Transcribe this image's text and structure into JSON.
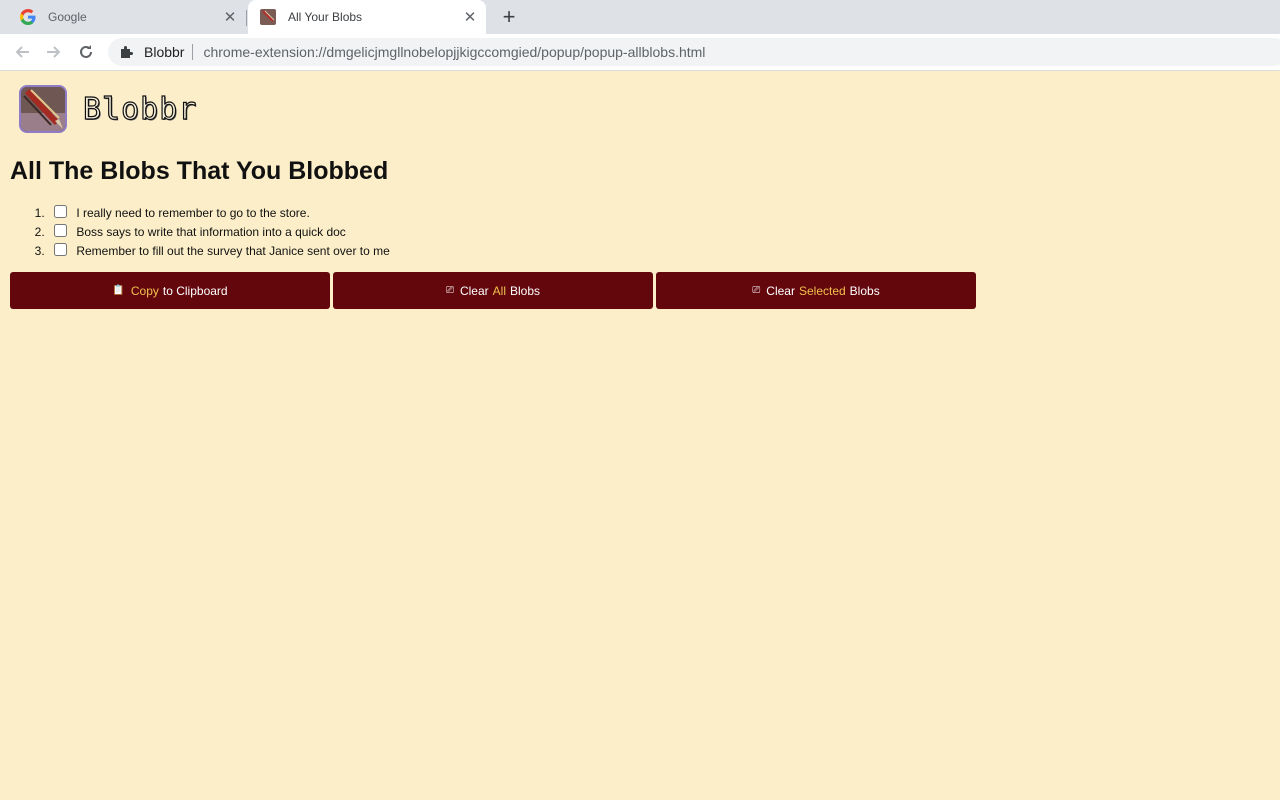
{
  "browser": {
    "tabs": [
      {
        "title": "Google",
        "favicon": "google-g-icon",
        "active": false
      },
      {
        "title": "All Your Blobs",
        "favicon": "blobbr-icon",
        "active": true
      }
    ],
    "address": {
      "extension_name": "Blobbr",
      "url": "chrome-extension://dmgelicjmgllnobelopjjkigccomgied/popup/popup-allblobs.html"
    }
  },
  "app": {
    "name": "Blobbr",
    "heading": "All The Blobs That You Blobbed",
    "background_color": "#fbeec8",
    "accent_color": "#63070d",
    "highlight_color": "#f2c14e"
  },
  "blobs": [
    {
      "number": "1.",
      "text": "I really need to remember to go to the store.",
      "checked": false
    },
    {
      "number": "2.",
      "text": "Boss says to write that information into a quick doc",
      "checked": false
    },
    {
      "number": "3.",
      "text": "Remember to fill out the survey that Janice sent over to me",
      "checked": false
    }
  ],
  "actions": [
    {
      "icon": "clipboard-icon",
      "before": "",
      "highlight": "Copy",
      "after": "to Clipboard"
    },
    {
      "icon": "clear-icon",
      "before": "Clear",
      "highlight": "All",
      "after": "Blobs"
    },
    {
      "icon": "clear-icon",
      "before": "Clear",
      "highlight": "Selected",
      "after": "Blobs"
    }
  ]
}
